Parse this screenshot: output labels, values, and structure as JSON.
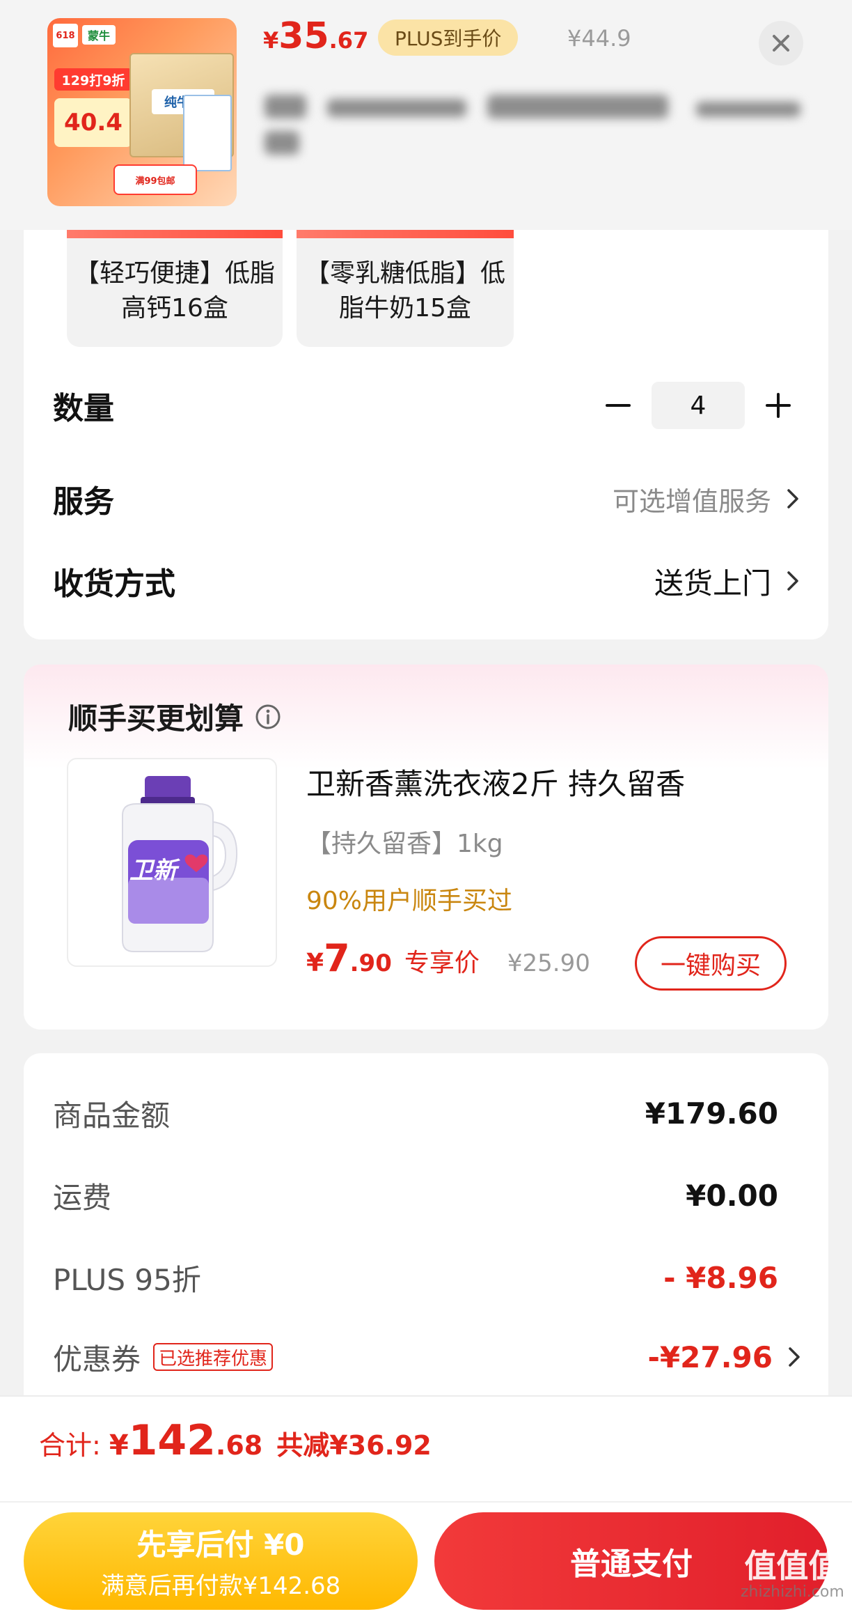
{
  "header": {
    "thumbnail": {
      "badge": "618",
      "brand": "蒙牛",
      "promo": "129打9折",
      "promo_price": "40.4",
      "box_label": "纯牛奶",
      "bottom_tag": "满99包邮"
    },
    "price_symbol": "¥",
    "price_int": "35",
    "price_dec": ".67",
    "plus_label": "PLUS到手价",
    "original_price": "¥44.9"
  },
  "specs": [
    {
      "label": "【轻巧便捷】低脂高钙16盒"
    },
    {
      "label": "【零乳糖低脂】低脂牛奶15盒"
    }
  ],
  "quantity": {
    "label": "数量",
    "value": "4"
  },
  "service": {
    "label": "服务",
    "value": "可选增值服务"
  },
  "delivery": {
    "label": "收货方式",
    "value": "送货上门"
  },
  "addon": {
    "title": "顺手买更划算",
    "name": "卫新香薰洗衣液2斤 持久留香",
    "spec": "【持久留香】1kg",
    "hot": "90%用户顺手买过",
    "price_symbol": "¥",
    "price_int": "7",
    "price_dec": ".90",
    "price_tag": "专享价",
    "original_price": "¥25.90",
    "buy_label": "一键购买",
    "bottle_brand": "卫新"
  },
  "summary": [
    {
      "label": "商品金额",
      "amount": "¥179.60"
    },
    {
      "label": "运费",
      "amount": "¥0.00"
    },
    {
      "label": "PLUS 95折",
      "amount": "- ¥8.96"
    },
    {
      "label": "优惠券",
      "tag": "已选推荐优惠",
      "amount": "-¥27.96"
    }
  ],
  "footer": {
    "total_label": "合计:",
    "total_symbol": "¥",
    "total_int": "142",
    "total_dec": ".68",
    "saved": "共减¥36.92",
    "pay_later_title": "先享后付 ¥0",
    "pay_later_sub": "满意后再付款¥142.68",
    "pay_normal": "普通支付"
  },
  "watermark": {
    "brand": "值值值",
    "site": "zhizhizhi.com"
  },
  "colors": {
    "accent": "#e1251b",
    "plus_pill": "#fbe3a6",
    "pay_later": "#ffc11a"
  }
}
